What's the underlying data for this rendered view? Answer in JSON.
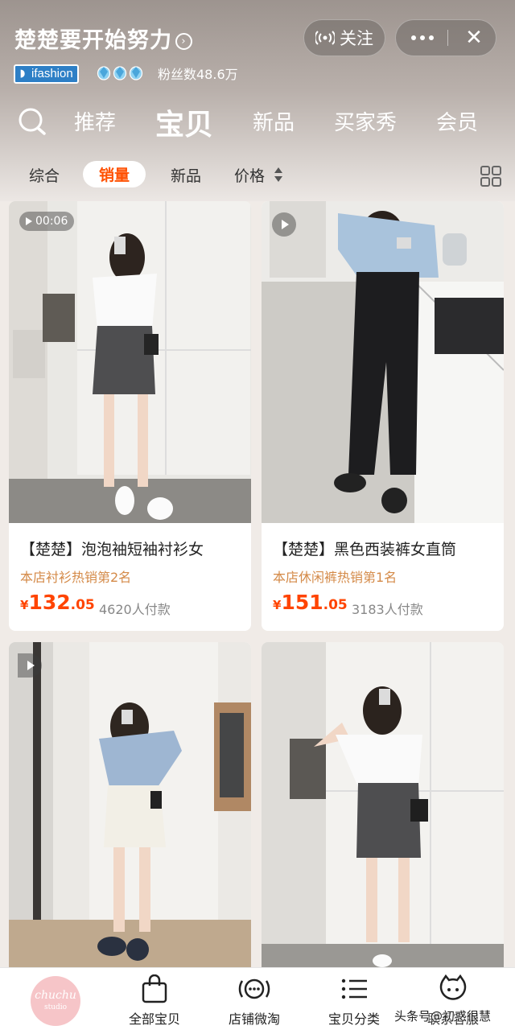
{
  "header": {
    "shop_name": "楚楚要开始努力",
    "follow_label": "关注",
    "close_label": "✕",
    "brand_badge": "ifashion",
    "fans": "粉丝数48.6万"
  },
  "tabs": [
    {
      "label": "推荐",
      "active": false
    },
    {
      "label": "宝贝",
      "active": true
    },
    {
      "label": "新品",
      "active": false
    },
    {
      "label": "买家秀",
      "active": false
    },
    {
      "label": "会员",
      "active": false
    }
  ],
  "filters": [
    {
      "label": "综合",
      "active": false
    },
    {
      "label": "销量",
      "active": true
    },
    {
      "label": "新品",
      "active": false
    },
    {
      "label": "价格",
      "active": false
    }
  ],
  "products": [
    {
      "video_time": "00:06",
      "title": "【楚楚】泡泡袖短袖衬衫女",
      "rank": "本店衬衫热销第2名",
      "currency": "¥",
      "price_int": "132",
      "price_dec": ".05",
      "sold": "4620人付款"
    },
    {
      "title": "【楚楚】黑色西装裤女直筒",
      "rank": "本店休闲裤热销第1名",
      "currency": "¥",
      "price_int": "151",
      "price_dec": ".05",
      "sold": "3183人付款"
    },
    {
      "title": "",
      "rank": ""
    },
    {
      "title": "",
      "rank": ""
    }
  ],
  "bottom_nav": {
    "logo_text": "chuchu",
    "logo_sub": "studio",
    "items": [
      {
        "label": "全部宝贝",
        "icon": "bag-icon"
      },
      {
        "label": "店铺微淘",
        "icon": "broadcast-icon"
      },
      {
        "label": "宝贝分类",
        "icon": "list-icon"
      },
      {
        "label": "联系客服",
        "icon": "service-icon"
      }
    ]
  },
  "watermark": "头条号@初惑很慧",
  "colors": {
    "accent": "#ff5000",
    "price": "#ff4400",
    "rank": "#d48a48"
  }
}
